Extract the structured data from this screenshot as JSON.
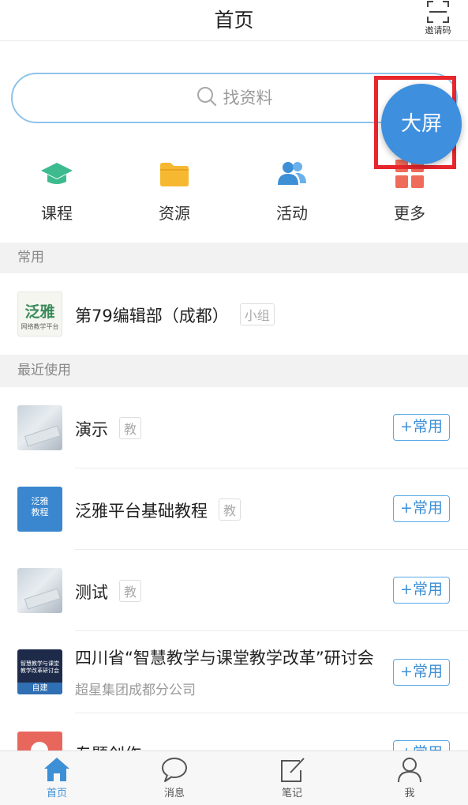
{
  "header": {
    "title": "首页",
    "invite_label": "邀请码"
  },
  "search": {
    "placeholder": "找资料"
  },
  "fab": {
    "label": "大屏"
  },
  "quick_nav": [
    {
      "label": "课程",
      "icon": "graduation-cap-icon",
      "color": "#3dbb8f"
    },
    {
      "label": "资源",
      "icon": "folder-icon",
      "color": "#f5b830"
    },
    {
      "label": "活动",
      "icon": "people-icon",
      "color": "#3d8fd6"
    },
    {
      "label": "更多",
      "icon": "grid-icon",
      "color": "#ef6b5a"
    }
  ],
  "sections": {
    "frequent": "常用",
    "recent": "最近使用"
  },
  "frequent_items": [
    {
      "title": "第79编辑部（成都）",
      "tag": "小组",
      "thumb_text": "泛雅",
      "thumb_sub": "网络教学平台"
    }
  ],
  "recent_items": [
    {
      "title": "演示",
      "tag": "教",
      "action": "+常用"
    },
    {
      "title": "泛雅平台基础教程",
      "tag": "教",
      "action": "+常用",
      "thumb_text": "泛雅\n教程"
    },
    {
      "title": "测试",
      "tag": "教",
      "action": "+常用"
    },
    {
      "title": "四川省“智慧教学与课堂教学改革”研讨会",
      "subtitle": "超星集团成都分公司",
      "action": "+常用",
      "thumb_label": "自建",
      "thumb_text": "智慧教学与课堂教学改革研讨会"
    },
    {
      "title": "专题创作",
      "action": "+常用"
    }
  ],
  "tabbar": [
    {
      "label": "首页",
      "icon": "home-icon",
      "active": true
    },
    {
      "label": "消息",
      "icon": "message-icon",
      "active": false
    },
    {
      "label": "笔记",
      "icon": "note-icon",
      "active": false
    },
    {
      "label": "我",
      "icon": "user-icon",
      "active": false
    }
  ],
  "colors": {
    "accent": "#3d8fd6",
    "highlight_border": "#e8262d"
  }
}
